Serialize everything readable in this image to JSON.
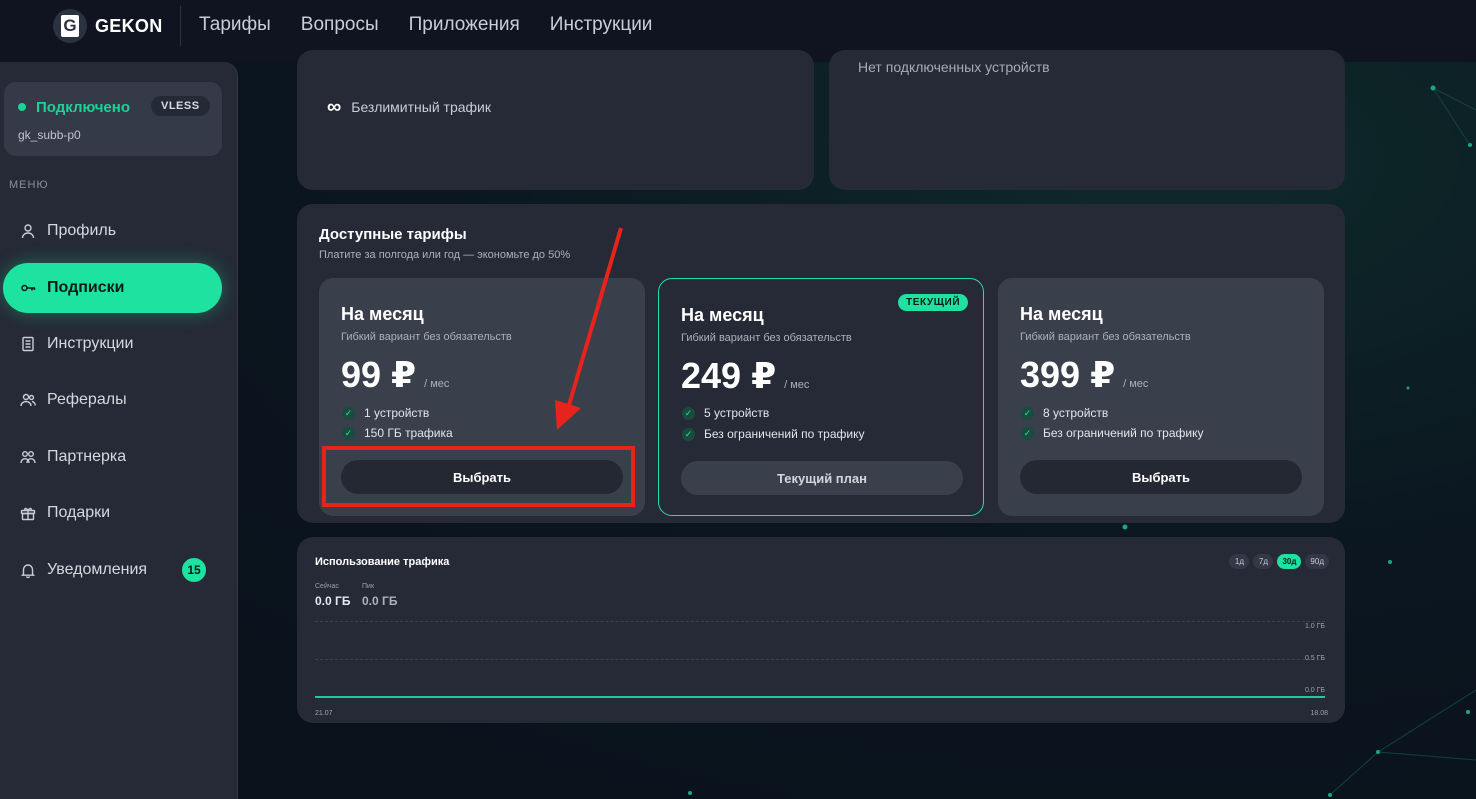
{
  "brand": {
    "name": "GEKON",
    "logo_letter": "G"
  },
  "topnav": [
    "Тарифы",
    "Вопросы",
    "Приложения",
    "Инструкции"
  ],
  "connection": {
    "status": "Подключено",
    "protocol": "VLESS",
    "user": "gk_subb-p0"
  },
  "menu": {
    "title": "МЕНЮ",
    "items": [
      {
        "label": "Профиль",
        "icon": "user-icon"
      },
      {
        "label": "Подписки",
        "icon": "key-icon",
        "active": true
      },
      {
        "label": "Инструкции",
        "icon": "document-icon"
      },
      {
        "label": "Рефералы",
        "icon": "users-icon"
      },
      {
        "label": "Партнерка",
        "icon": "partners-icon"
      },
      {
        "label": "Подарки",
        "icon": "gift-icon"
      },
      {
        "label": "Уведомления",
        "icon": "bell-icon",
        "badge": "15"
      }
    ]
  },
  "top_cards": {
    "traffic": "Безлимитный трафик",
    "devices": "Нет подключенных устройств"
  },
  "tariffs": {
    "title": "Доступные тарифы",
    "subtitle": "Платите за полгода или год — экономьте до 50%",
    "plans": [
      {
        "name": "На месяц",
        "desc": "Гибкий вариант без обязательств",
        "price": "99 ₽",
        "per": "/ мес",
        "features": [
          "1 устройств",
          "150 ГБ трафика"
        ],
        "button": "Выбрать",
        "current": false
      },
      {
        "name": "На месяц",
        "desc": "Гибкий вариант без обязательств",
        "price": "249 ₽",
        "per": "/ мес",
        "features": [
          "5 устройств",
          "Без ограничений по трафику"
        ],
        "button": "Текущий план",
        "current": true,
        "badge": "ТЕКУЩИЙ"
      },
      {
        "name": "На месяц",
        "desc": "Гибкий вариант без обязательств",
        "price": "399 ₽",
        "per": "/ мес",
        "features": [
          "8 устройств",
          "Без ограничений по трафику"
        ],
        "button": "Выбрать",
        "current": false
      }
    ]
  },
  "traffic": {
    "title": "Использование трафика",
    "ranges": [
      "1д",
      "7д",
      "30д",
      "90д"
    ],
    "selected_range": "30д",
    "now_label": "Сейчас",
    "now_value": "0.0 ГБ",
    "peak_label": "Пик",
    "peak_value": "0.0 ГБ",
    "y_ticks": [
      "1.0 ГБ",
      "0.5 ГБ",
      "0.0 ГБ"
    ],
    "x_start": "21.07",
    "x_end": "18.08"
  },
  "colors": {
    "accent": "#1ee3a0",
    "annotation": "#e8231c"
  }
}
